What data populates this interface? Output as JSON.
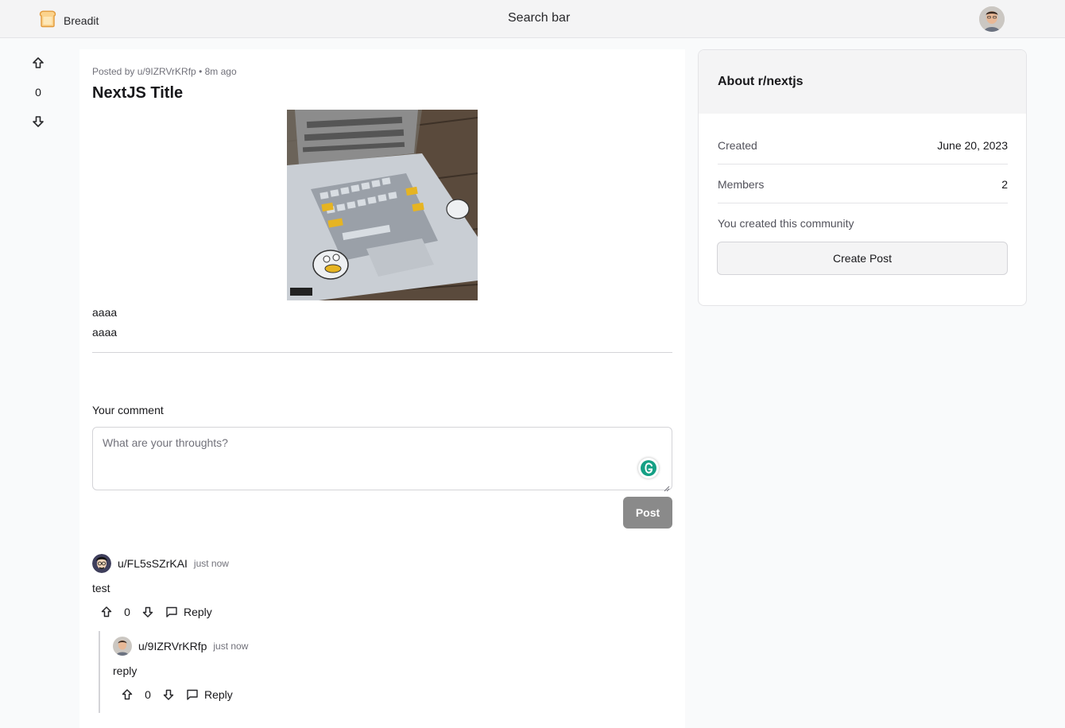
{
  "navbar": {
    "brand": "Breadit",
    "search_label": "Search bar"
  },
  "post": {
    "vote_count": "0",
    "meta": "Posted by u/9IZRVrKRfp • 8m ago",
    "title": "NextJS Title",
    "body_lines": [
      "aaaa",
      "aaaa"
    ]
  },
  "comment_form": {
    "label": "Your comment",
    "placeholder": "What are your throughts?",
    "submit": "Post"
  },
  "comments": [
    {
      "user": "u/FL5sSZrKAI",
      "time": "just now",
      "text": "test",
      "votes": "0",
      "reply_label": "Reply"
    },
    {
      "user": "u/9IZRVrKRfp",
      "time": "just now",
      "text": "reply",
      "votes": "0",
      "reply_label": "Reply"
    }
  ],
  "sidebar": {
    "title": "About r/nextjs",
    "created_label": "Created",
    "created_value": "June 20, 2023",
    "members_label": "Members",
    "members_value": "2",
    "note": "You created this community",
    "create_button": "Create Post"
  },
  "colors": {
    "post_button": "#8a8a8a",
    "grammarly": "#15a085"
  }
}
